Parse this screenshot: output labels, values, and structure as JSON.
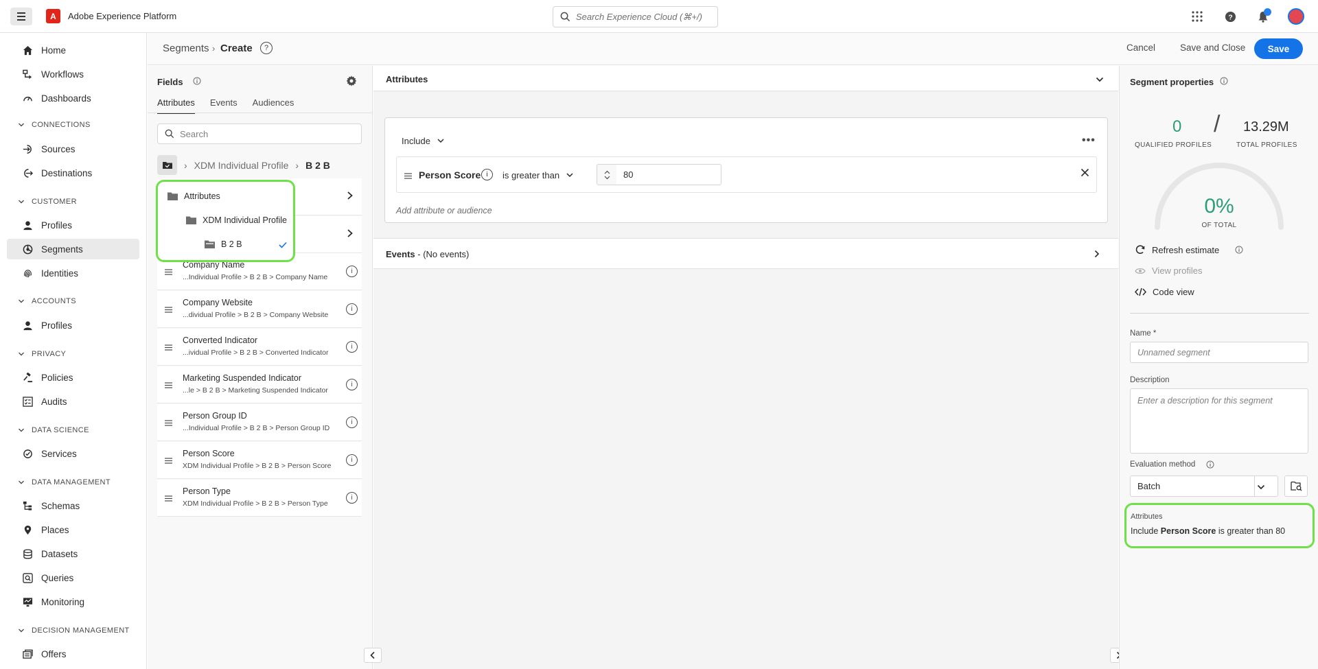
{
  "app": {
    "title": "Adobe Experience Platform",
    "logo_letter": "A",
    "search_placeholder": "Search Experience Cloud (⌘+/)"
  },
  "nav": {
    "items_top": [
      {
        "label": "Home",
        "icon": "home-icon"
      },
      {
        "label": "Workflows",
        "icon": "workflows-icon"
      },
      {
        "label": "Dashboards",
        "icon": "dashboards-icon"
      }
    ],
    "sections": [
      {
        "title": "CONNECTIONS",
        "items": [
          "Sources",
          "Destinations"
        ]
      },
      {
        "title": "CUSTOMER",
        "items": [
          "Profiles",
          "Segments",
          "Identities"
        ]
      },
      {
        "title": "ACCOUNTS",
        "items": [
          "Profiles"
        ]
      },
      {
        "title": "PRIVACY",
        "items": [
          "Policies",
          "Audits"
        ]
      },
      {
        "title": "DATA SCIENCE",
        "items": [
          "Services"
        ]
      },
      {
        "title": "DATA MANAGEMENT",
        "items": [
          "Schemas",
          "Places",
          "Datasets",
          "Queries",
          "Monitoring"
        ]
      },
      {
        "title": "DECISION MANAGEMENT",
        "items": [
          "Offers"
        ]
      }
    ],
    "active": "Segments"
  },
  "header": {
    "breadcrumb_parent": "Segments",
    "breadcrumb_current": "Create",
    "cancel": "Cancel",
    "save_close": "Save and Close",
    "save": "Save"
  },
  "fields": {
    "title": "Fields",
    "tabs": [
      "Attributes",
      "Events",
      "Audiences"
    ],
    "search_placeholder": "Search",
    "path": [
      "XDM Individual Profile",
      "B 2 B"
    ],
    "tree": {
      "level1": "Attributes",
      "level2": "XDM Individual Profile",
      "level3": "B 2 B"
    },
    "rows": [
      {
        "name": "Company Name",
        "path": "...Individual Profile > B 2 B > Company Name"
      },
      {
        "name": "Company Website",
        "path": "...dividual Profile > B 2 B > Company Website"
      },
      {
        "name": "Converted Indicator",
        "path": "...ividual Profile > B 2 B > Converted Indicator"
      },
      {
        "name": "Marketing Suspended Indicator",
        "path": "...le > B 2 B > Marketing Suspended Indicator"
      },
      {
        "name": "Person Group ID",
        "path": "...Individual Profile > B 2 B > Person Group ID"
      },
      {
        "name": "Person Score",
        "path": "XDM Individual Profile > B 2 B > Person Score"
      },
      {
        "name": "Person Type",
        "path": "XDM Individual Profile > B 2 B > Person Type"
      }
    ]
  },
  "canvas": {
    "attributes_title": "Attributes",
    "include_label": "Include",
    "condition": {
      "attribute": "Person Score",
      "operator": "is greater than",
      "value": "80"
    },
    "add_placeholder": "Add attribute or audience",
    "events_title": "Events",
    "events_suffix": " - (No events)"
  },
  "properties": {
    "title": "Segment properties",
    "qualified": "0",
    "qualified_label": "QUALIFIED PROFILES",
    "total": "13.29M",
    "total_label": "TOTAL PROFILES",
    "percent": "0%",
    "percent_label": "OF TOTAL",
    "percent_value": 0,
    "refresh": "Refresh estimate",
    "view_profiles": "View profiles",
    "code_view": "Code view",
    "name_label": "Name *",
    "name_placeholder": "Unnamed segment",
    "description_label": "Description",
    "description_placeholder": "Enter a description for this segment",
    "evaluation_label": "Evaluation method",
    "evaluation_value": "Batch",
    "summary_title": "Attributes",
    "summary_prefix": "Include ",
    "summary_attr": "Person Score",
    "summary_suffix": " is greater than 80"
  },
  "colors": {
    "accent": "#1473e6",
    "highlight": "#6fe04a",
    "positive": "#2d9d78"
  }
}
